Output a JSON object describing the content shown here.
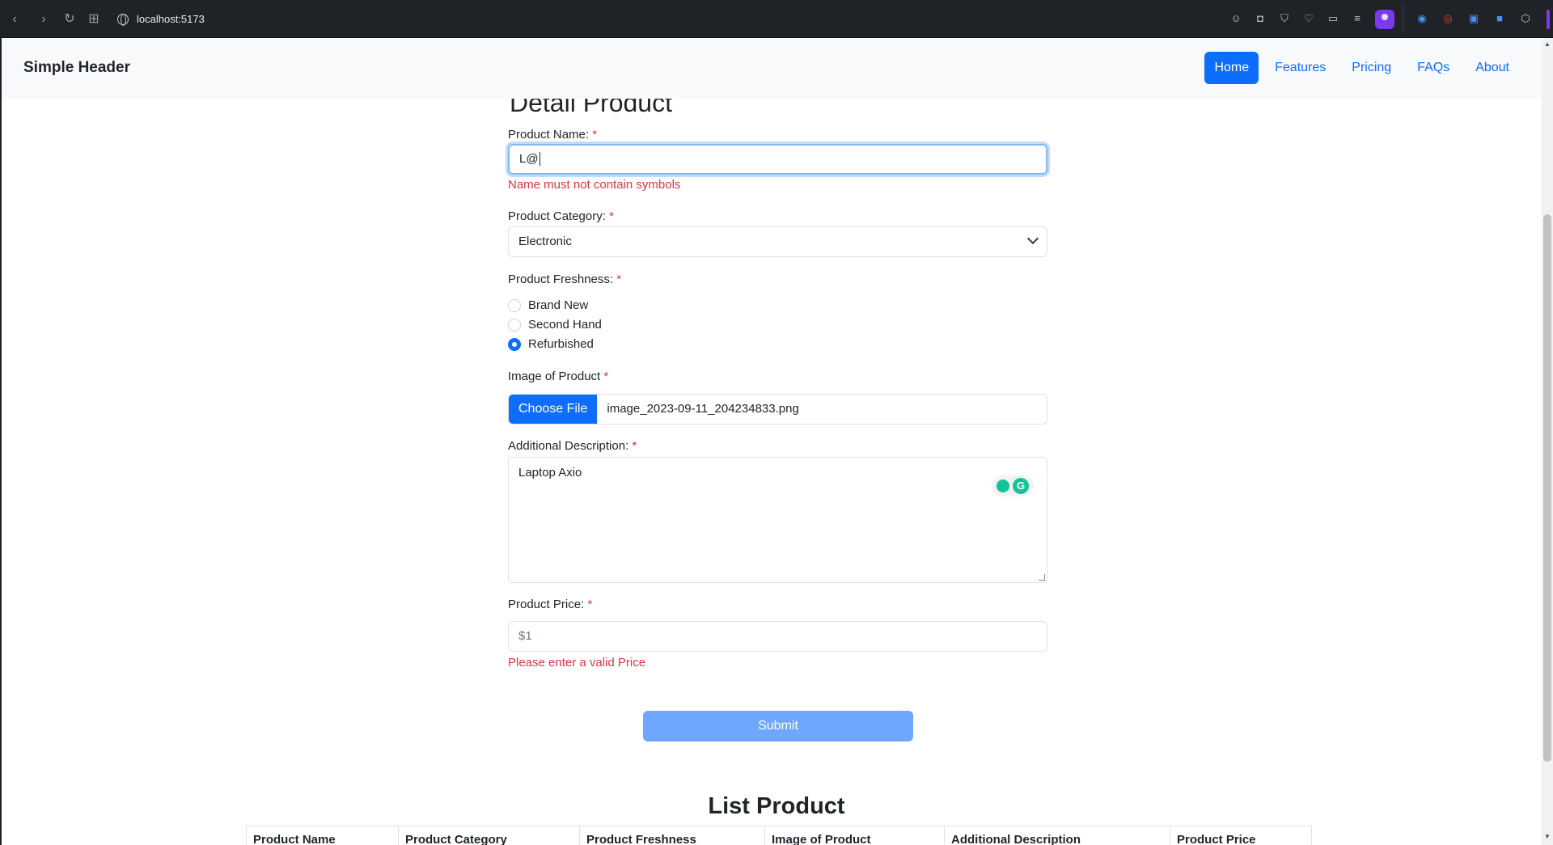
{
  "browser": {
    "url": "localhost:5173"
  },
  "header": {
    "brand": "Simple Header",
    "nav": [
      "Home",
      "Features",
      "Pricing",
      "FAQs",
      "About"
    ]
  },
  "form": {
    "title": "Detail Product",
    "required_marker": "*",
    "product_name": {
      "label": "Product Name:",
      "value": "L@",
      "error": "Name must not contain symbols"
    },
    "product_category": {
      "label": "Product Category:",
      "selected": "Electronic"
    },
    "product_freshness": {
      "label": "Product Freshness:",
      "options": [
        "Brand New",
        "Second Hand",
        "Refurbished"
      ],
      "selected": "Refurbished"
    },
    "image": {
      "label": "Image of Product",
      "button": "Choose File",
      "file_name": "image_2023-09-11_204234833.png"
    },
    "description": {
      "label": "Additional Description:",
      "value": "Laptop Axio"
    },
    "price": {
      "label": "Product Price:",
      "value": "$1",
      "error": "Please enter a valid Price"
    },
    "submit": "Submit"
  },
  "list": {
    "title": "List Product",
    "columns": [
      "Product Name",
      "Product Category",
      "Product Freshness",
      "Image of Product",
      "Additional Description",
      "Product Price"
    ]
  }
}
